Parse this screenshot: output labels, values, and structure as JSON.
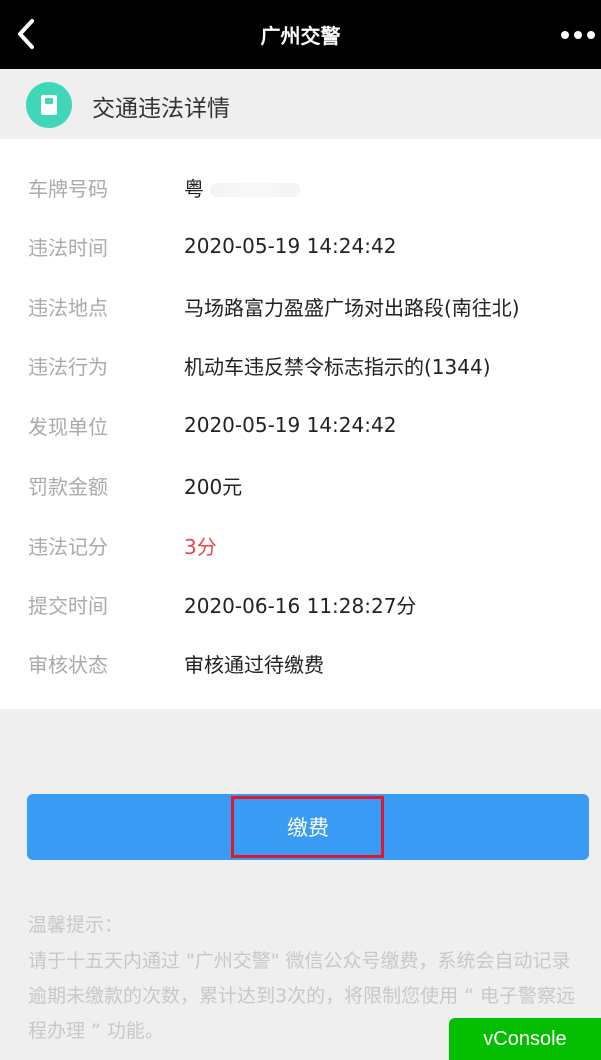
{
  "header": {
    "title": "广州交警",
    "back_icon": "chevron-left-icon",
    "more_icon": "more-dots-icon"
  },
  "section": {
    "title": "交通违法详情",
    "icon": "document-icon",
    "icon_color": "#3ed7b7"
  },
  "details": [
    {
      "label": "车牌号码",
      "value": "粤"
    },
    {
      "label": "违法时间",
      "value": "2020-05-19 14:24:42"
    },
    {
      "label": "违法地点",
      "value": "马场路富力盈盛广场对出路段(南往北)"
    },
    {
      "label": "违法行为",
      "value": "机动车违反禁令标志指示的(1344)"
    },
    {
      "label": "发现单位",
      "value": "2020-05-19 14:24:42"
    },
    {
      "label": "罚款金额",
      "value": "200元"
    },
    {
      "label": "违法记分",
      "value": "3分"
    },
    {
      "label": "提交时间",
      "value": "2020-06-16 11:28:27分"
    },
    {
      "label": "审核状态",
      "value": "审核通过待缴费"
    }
  ],
  "pay_button": {
    "label": "缴费",
    "color": "#3a9bf5"
  },
  "tips": {
    "title": "温馨提示：",
    "text": "请于十五天内通过 \"广州交警\" 微信公众号缴费，系统会自动记录逾期未缴款的次数，累计达到3次的，将限制您使用 “ 电子警察远程办理 ” 功能。"
  },
  "vconsole": {
    "label": "vConsole",
    "color": "#04be02"
  },
  "colors": {
    "points_red": "#e5484d",
    "highlight_red": "#e0182c"
  }
}
